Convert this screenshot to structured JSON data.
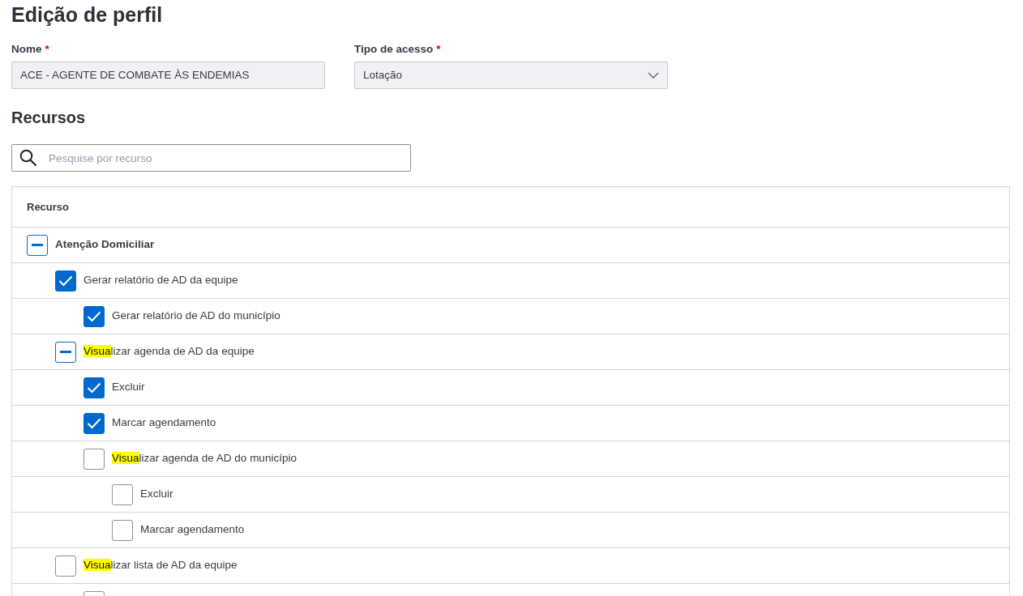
{
  "title": "Edição de perfil",
  "fields": [
    {
      "kind": "text",
      "label": "Nome",
      "required_mark": "*",
      "value": "ACE - AGENTE DE COMBATE ÀS ENDEMIAS"
    },
    {
      "kind": "select",
      "label": "Tipo de acesso",
      "required_mark": "*",
      "value": "Lotação"
    }
  ],
  "section_title": "Recursos",
  "search": {
    "placeholder": "Pesquise por recurso"
  },
  "table": {
    "column": "Recurso",
    "rows": [
      {
        "label": "Atenção Domiciliar",
        "bold": true,
        "checked": false,
        "partial": true,
        "children": [
          {
            "label": "Gerar relatório de AD da equipe",
            "bold": false,
            "checked": true,
            "partial": false,
            "children": [
              {
                "label": "Gerar relatório de AD do município",
                "bold": false,
                "checked": true,
                "partial": false
              }
            ]
          },
          {
            "highlight": "Visua",
            "label": "lizar agenda de AD da equipe",
            "bold": false,
            "checked": false,
            "partial": true,
            "children": [
              {
                "label": "Excluir",
                "bold": false,
                "checked": true,
                "partial": false
              },
              {
                "label": "Marcar agendamento",
                "bold": false,
                "checked": true,
                "partial": false
              },
              {
                "highlight": "Visua",
                "label": "lizar agenda de AD do município",
                "bold": false,
                "checked": false,
                "partial": false,
                "children": [
                  {
                    "label": "Excluir",
                    "bold": false,
                    "checked": false,
                    "partial": false
                  },
                  {
                    "label": "Marcar agendamento",
                    "bold": false,
                    "checked": false,
                    "partial": false
                  }
                ]
              }
            ]
          },
          {
            "highlight": "Visua",
            "label": "lizar lista de AD da equipe",
            "bold": false,
            "checked": false,
            "partial": false,
            "children": [
              {
                "checked": false,
                "partial": false
              }
            ]
          }
        ]
      }
    ]
  }
}
